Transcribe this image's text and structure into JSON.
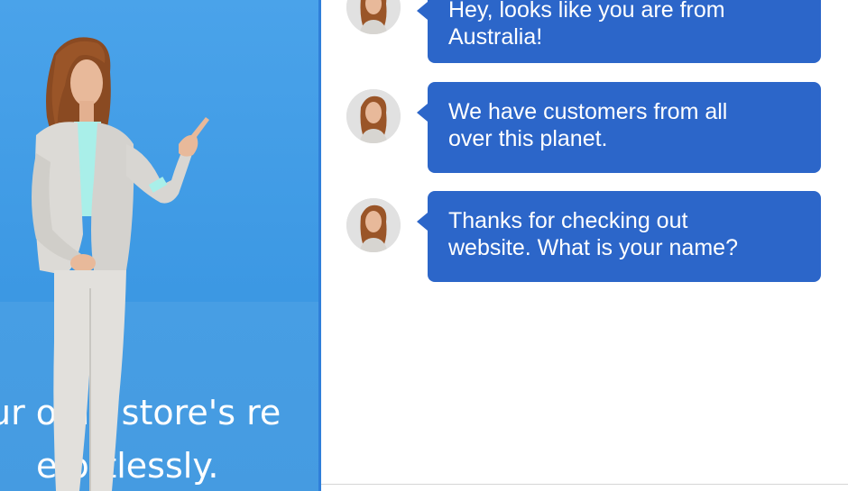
{
  "hero": {
    "line1": "ur o    ne store's re",
    "line2": "e  ortlessly."
  },
  "chat": {
    "messages": [
      {
        "lines": [
          "Hey, looks like you are from",
          "Australia!"
        ]
      },
      {
        "lines": [
          "We have customers from all",
          "over this planet."
        ]
      },
      {
        "lines": [
          "Thanks for checking out",
          "website. What is your name?"
        ]
      }
    ]
  },
  "colors": {
    "hero_bg": "#3c98e3",
    "bubble_bg": "#2c66c9",
    "panel_border": "#2f7fd9"
  },
  "icons": {
    "agent_avatar": "agent-avatar-icon",
    "assistant_figure": "virtual-assistant-figure"
  }
}
